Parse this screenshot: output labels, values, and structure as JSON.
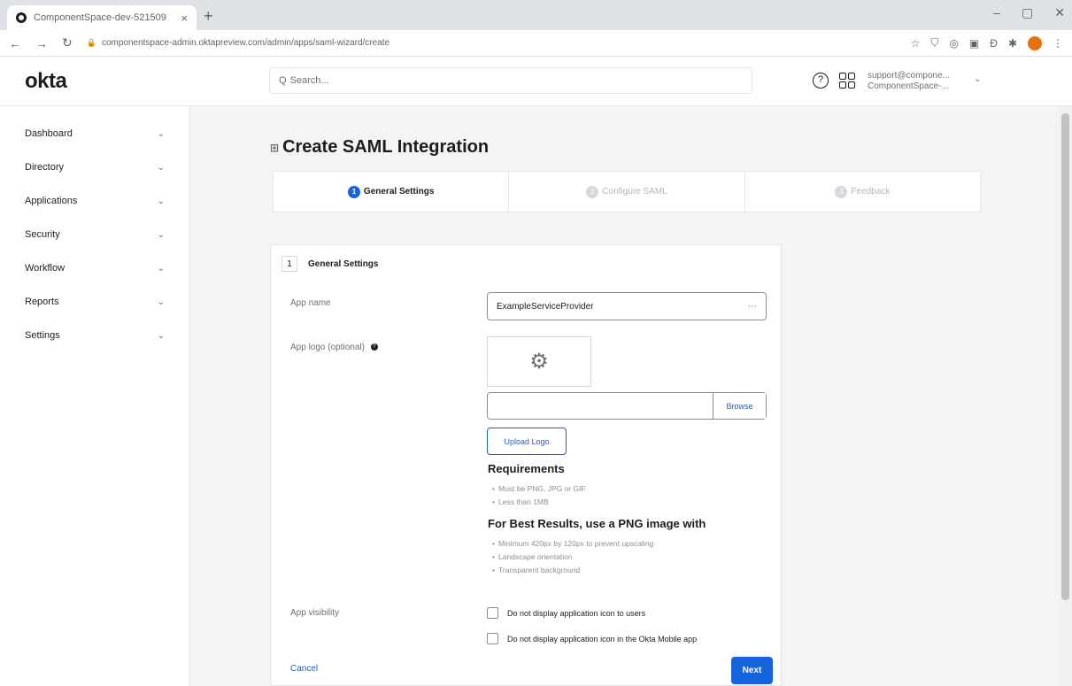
{
  "browser": {
    "tab_title": "ComponentSpace-dev-521509",
    "tab_close": "×",
    "new_tab": "+",
    "url": "componentspace-admin.oktapreview.com/admin/apps/saml-wizard/create",
    "window_controls": [
      "–",
      "▢",
      "✕"
    ]
  },
  "header": {
    "logo": "okta",
    "search_placeholder": "Search...",
    "user_line1": "support@compone...",
    "user_line2": "ComponentSpace-..."
  },
  "sidebar": {
    "items": [
      {
        "label": "Dashboard"
      },
      {
        "label": "Directory"
      },
      {
        "label": "Applications"
      },
      {
        "label": "Security"
      },
      {
        "label": "Workflow"
      },
      {
        "label": "Reports"
      },
      {
        "label": "Settings"
      }
    ]
  },
  "page": {
    "title": "Create SAML Integration",
    "steps": [
      {
        "num": "1",
        "label": "General Settings",
        "active": true
      },
      {
        "num": "2",
        "label": "Configure SAML",
        "active": false
      },
      {
        "num": "3",
        "label": "Feedback",
        "active": false
      }
    ]
  },
  "form": {
    "section_num": "1",
    "section_title": "General Settings",
    "app_name_label": "App name",
    "app_name_value": "ExampleServiceProvider",
    "app_logo_label": "App logo (optional)",
    "browse_label": "Browse",
    "upload_label": "Upload Logo",
    "requirements_title": "Requirements",
    "requirements": [
      "Must be PNG, JPG or GIF",
      "Less than 1MB"
    ],
    "best_title": "For Best Results, use a PNG image with",
    "best_items": [
      "Minimum 420px by 120px to prevent upscaling",
      "Landscape orientation",
      "Transparent background"
    ],
    "visibility_label": "App visibility",
    "visibility_options": [
      "Do not display application icon to users",
      "Do not display application icon in the Okta Mobile app"
    ],
    "cancel_label": "Cancel",
    "next_label": "Next"
  }
}
